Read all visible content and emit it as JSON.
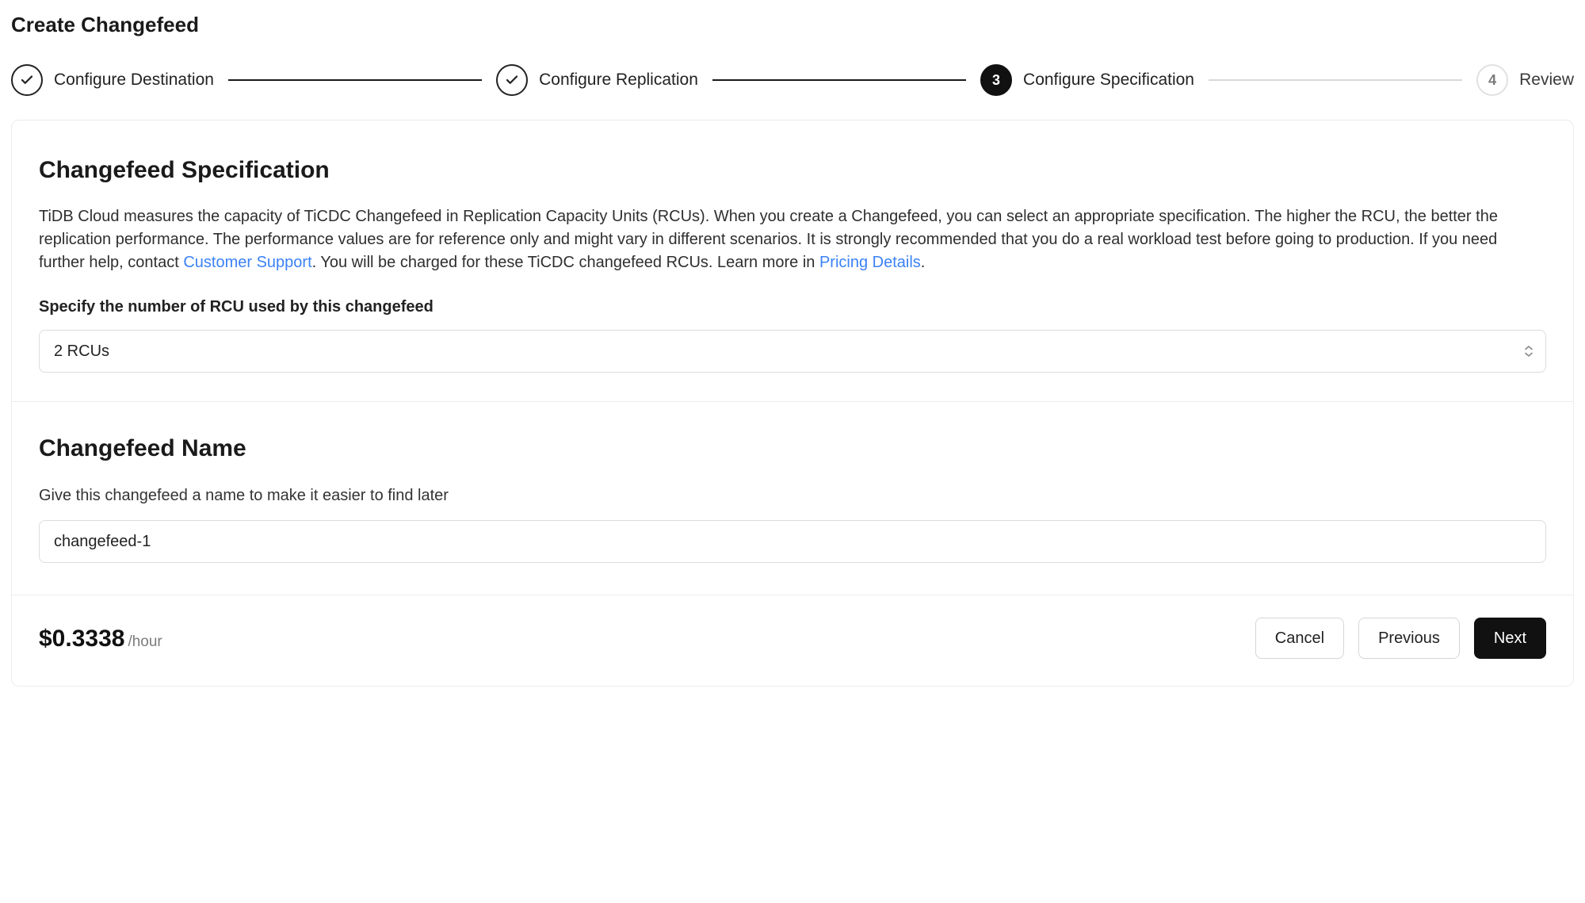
{
  "page_title": "Create Changefeed",
  "steps": {
    "s1": {
      "label": "Configure Destination"
    },
    "s2": {
      "label": "Configure Replication"
    },
    "s3": {
      "label": "Configure Specification",
      "number": "3"
    },
    "s4": {
      "label": "Review",
      "number": "4"
    }
  },
  "spec": {
    "title": "Changefeed Specification",
    "desc_part1": "TiDB Cloud measures the capacity of TiCDC Changefeed in Replication Capacity Units (RCUs). When you create a Changefeed, you can select an appropriate specification. The higher the RCU, the better the replication performance. The performance values are for reference only and might vary in different scenarios. It is strongly recommended that you do a real workload test before going to production. If you need further help, contact ",
    "link1_text": "Customer Support",
    "desc_part2": ". You will be charged for these TiCDC changefeed RCUs. Learn more in ",
    "link2_text": "Pricing Details",
    "desc_part3": ".",
    "rcu_label": "Specify the number of RCU used by this changefeed",
    "rcu_value": "2 RCUs"
  },
  "name_section": {
    "title": "Changefeed Name",
    "sublabel": "Give this changefeed a name to make it easier to find later",
    "value": "changefeed-1"
  },
  "footer": {
    "price_amount": "$0.3338",
    "price_unit": "/hour",
    "cancel": "Cancel",
    "previous": "Previous",
    "next": "Next"
  }
}
